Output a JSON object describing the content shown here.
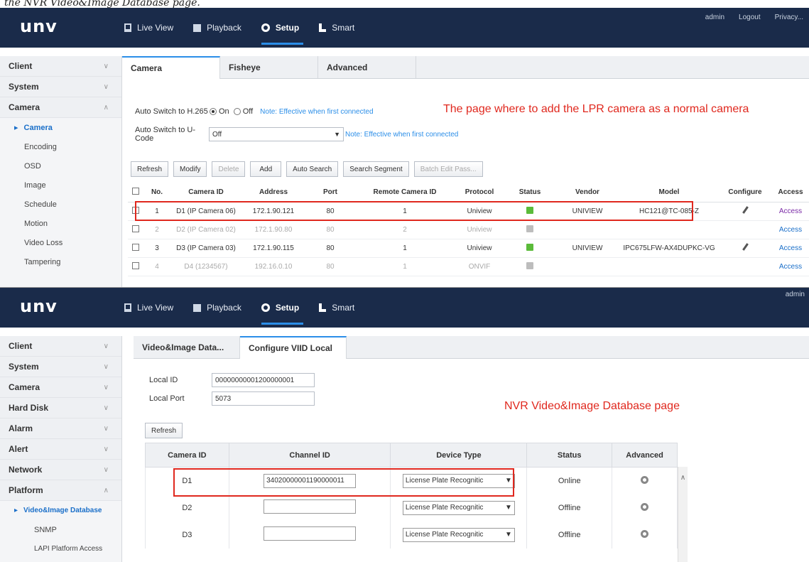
{
  "caption": "the NVR Video&Image Database page.",
  "pane1": {
    "logo": "unv",
    "nav": [
      {
        "label": "Live View",
        "icon": "monitor-icon"
      },
      {
        "label": "Playback",
        "icon": "film-icon"
      },
      {
        "label": "Setup",
        "icon": "gear-icon",
        "active": true
      },
      {
        "label": "Smart",
        "icon": "smart-icon"
      }
    ],
    "top_right": [
      "admin",
      "Logout",
      "Privacy..."
    ],
    "sidebar": {
      "groups": [
        "Client",
        "System",
        "Camera"
      ],
      "items": [
        "Camera",
        "Encoding",
        "OSD",
        "Image",
        "Schedule",
        "Motion",
        "Video Loss",
        "Tampering"
      ]
    },
    "tabs": [
      "Camera",
      "Fisheye",
      "Advanced"
    ],
    "h265_label": "Auto Switch to H.265",
    "on_label": "On",
    "off_label": "Off",
    "h265_note": "Note: Effective when first connected",
    "ucode_label": "Auto Switch to U-Code",
    "ucode_value": "Off",
    "ucode_note": "Note: Effective when first connected",
    "red_note": "The page where to add the LPR camera as a normal camera",
    "buttons": [
      "Refresh",
      "Modify",
      "Delete",
      "Add",
      "Auto Search",
      "Search Segment",
      "Batch Edit Pass..."
    ],
    "columns": [
      "No.",
      "Camera ID",
      "Address",
      "Port",
      "Remote Camera ID",
      "Protocol",
      "Status",
      "Vendor",
      "Model",
      "Configure",
      "Access"
    ],
    "rows": [
      {
        "no": "1",
        "id": "D1 (IP Camera 06)",
        "addr": "172.1.90.121",
        "port": "80",
        "remote": "1",
        "proto": "Uniview",
        "vendor": "UNIVIEW",
        "model": "HC121@TC-085-Z",
        "access": "Access"
      },
      {
        "no": "2",
        "id": "D2 (IP Camera 02)",
        "addr": "172.1.90.80",
        "port": "80",
        "remote": "2",
        "proto": "Uniview",
        "vendor": "",
        "model": "",
        "access": "Access"
      },
      {
        "no": "3",
        "id": "D3 (IP Camera 03)",
        "addr": "172.1.90.115",
        "port": "80",
        "remote": "1",
        "proto": "Uniview",
        "vendor": "UNIVIEW",
        "model": "IPC675LFW-AX4DUPKC-VG",
        "access": "Access"
      },
      {
        "no": "4",
        "id": "D4 (1234567)",
        "addr": "192.16.0.10",
        "port": "80",
        "remote": "1",
        "proto": "ONVIF",
        "vendor": "",
        "model": "",
        "access": "Access"
      }
    ]
  },
  "pane2": {
    "logo": "unv",
    "nav": [
      "Live View",
      "Playback",
      "Setup",
      "Smart"
    ],
    "top_right": "admin",
    "sidebar": {
      "groups": [
        "Client",
        "System",
        "Camera",
        "Hard Disk",
        "Alarm",
        "Alert",
        "Network",
        "Platform"
      ],
      "items": [
        "Video&Image Database",
        "SNMP",
        "LAPI Platform Access"
      ]
    },
    "tabs": [
      "Video&Image Data...",
      "Configure VIID Local"
    ],
    "local_id_label": "Local ID",
    "local_id_value": "00000000001200000001",
    "local_port_label": "Local Port",
    "local_port_value": "5073",
    "red_note": "NVR Video&Image Database page",
    "refresh": "Refresh",
    "columns": [
      "Camera ID",
      "Channel ID",
      "Device Type",
      "Status",
      "Advanced"
    ],
    "rows": [
      {
        "cam": "D1",
        "channel": "34020000001190000011",
        "type": "License Plate Recognitic",
        "status": "Online"
      },
      {
        "cam": "D2",
        "channel": "",
        "type": "License Plate Recognitic",
        "status": "Offline"
      },
      {
        "cam": "D3",
        "channel": "",
        "type": "License Plate Recognitic",
        "status": "Offline"
      }
    ]
  }
}
